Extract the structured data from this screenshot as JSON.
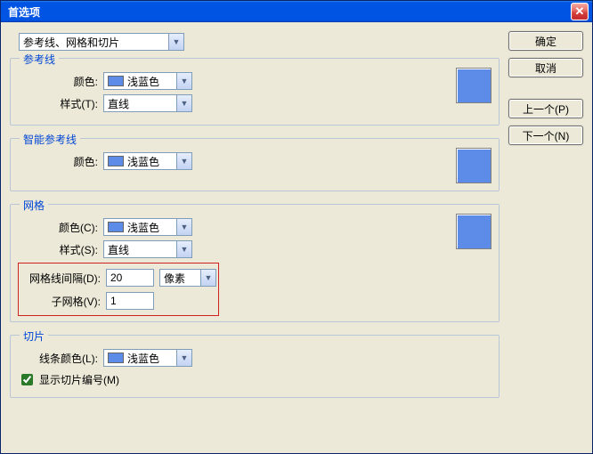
{
  "window": {
    "title": "首选项"
  },
  "topSelect": {
    "value": "参考线、网格和切片"
  },
  "buttons": {
    "ok": "确定",
    "cancel": "取消",
    "prev": "上一个(P)",
    "next": "下一个(N)"
  },
  "groups": {
    "guides": {
      "legend": "参考线",
      "colorLabel": "颜色:",
      "colorValue": "浅蓝色",
      "colorHex": "#5c8ce8",
      "styleLabel": "样式(T):",
      "styleValue": "直线"
    },
    "smartGuides": {
      "legend": "智能参考线",
      "colorLabel": "颜色:",
      "colorValue": "浅蓝色",
      "colorHex": "#5c8ce8"
    },
    "grid": {
      "legend": "网格",
      "colorLabel": "颜色(C):",
      "colorValue": "浅蓝色",
      "colorHex": "#5c8ce8",
      "styleLabel": "样式(S):",
      "styleValue": "直线",
      "spacingLabel": "网格线间隔(D):",
      "spacingValue": "20",
      "unitValue": "像素",
      "subgridLabel": "子网格(V):",
      "subgridValue": "1"
    },
    "slices": {
      "legend": "切片",
      "colorLabel": "线条颜色(L):",
      "colorValue": "浅蓝色",
      "colorHex": "#5c8ce8",
      "showNumbersLabel": "显示切片编号(M)",
      "showNumbersChecked": true
    }
  }
}
